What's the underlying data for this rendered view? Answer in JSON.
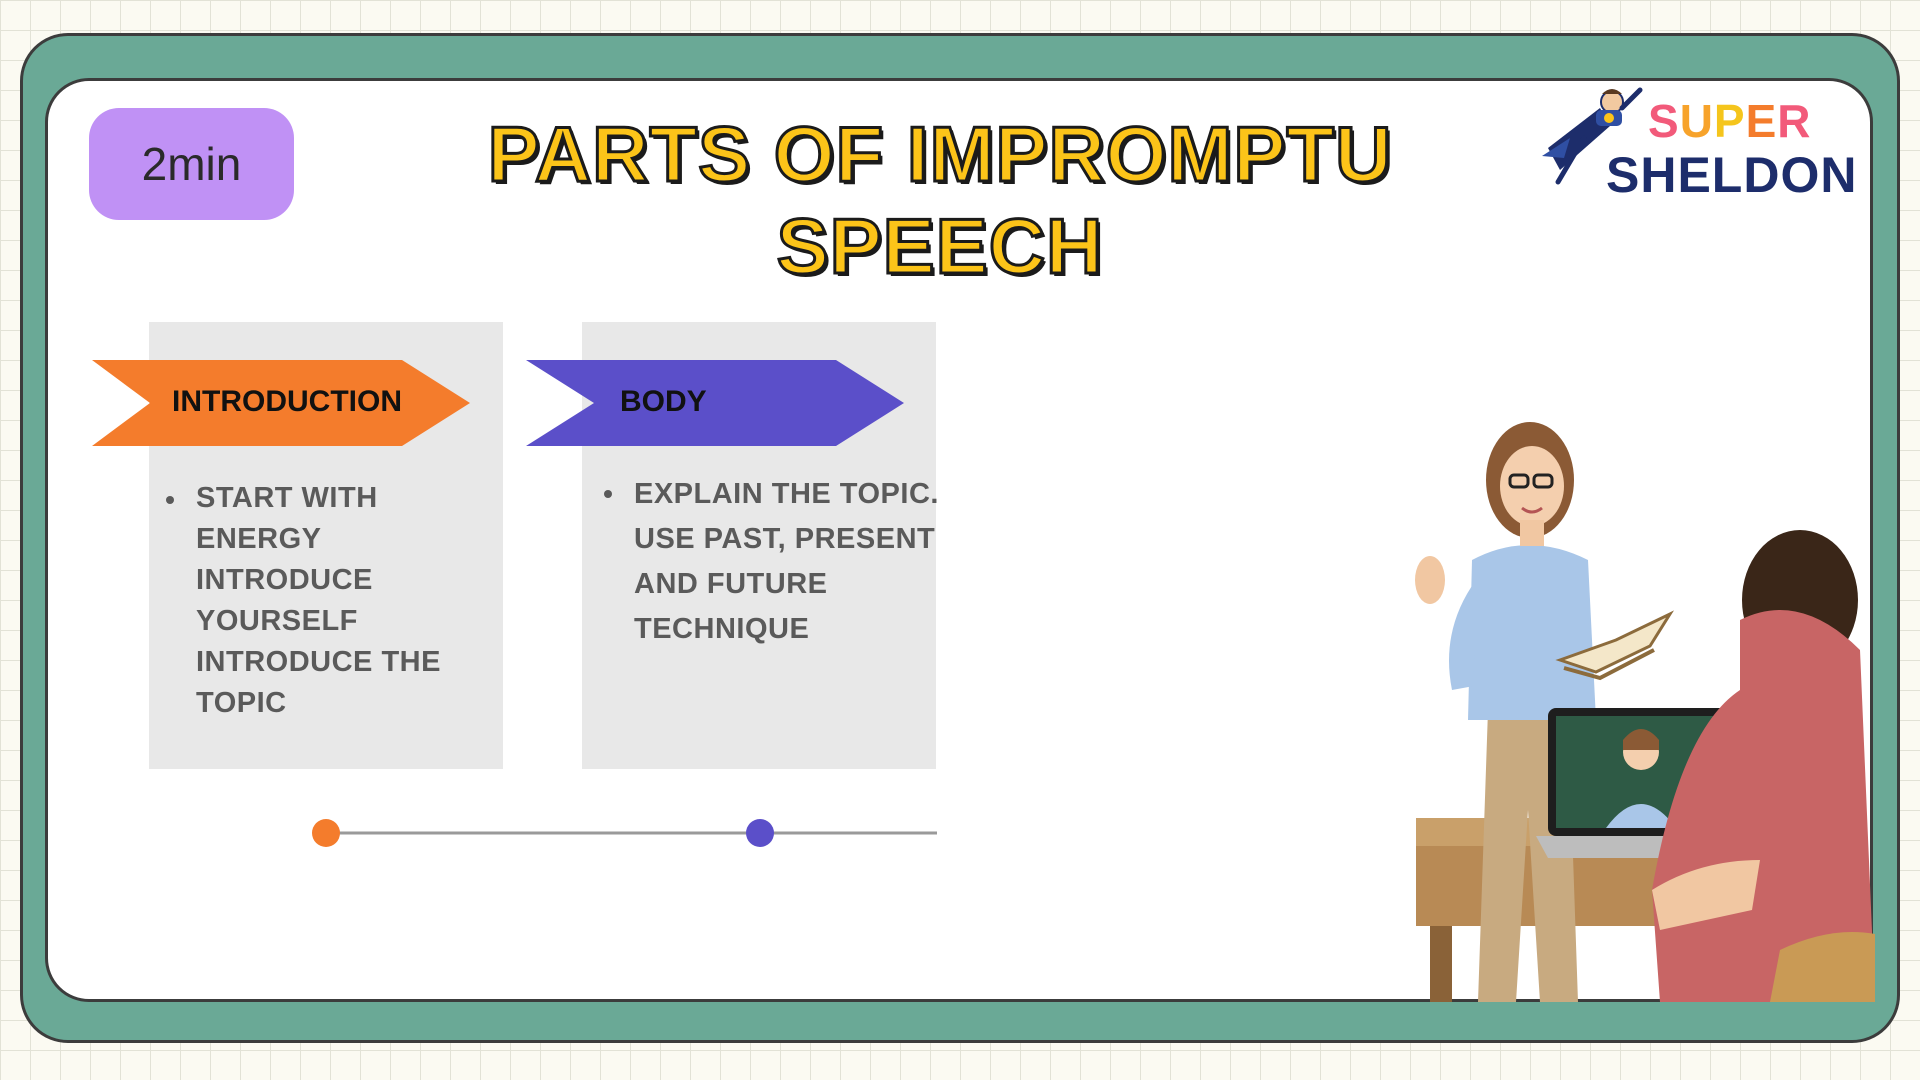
{
  "timer": {
    "label": "2min"
  },
  "title": {
    "line1": "PARTS OF IMPROMPTU",
    "line2": "SPEECH"
  },
  "logo": {
    "word1": "SUPER",
    "word2": "SHELDON"
  },
  "sections": [
    {
      "label": "INTRODUCTION",
      "color": "#f47c2c",
      "bullets": [
        "START WITH ENERGY INTRODUCE YOURSELF INTRODUCE THE TOPIC"
      ]
    },
    {
      "label": "BODY",
      "color": "#5b4fc9",
      "bullets": [
        "EXPLAIN THE TOPIC. USE PAST, PRESENT AND FUTURE TECHNIQUE"
      ]
    }
  ],
  "colors": {
    "frame": "#6aa996",
    "timer_bg": "#c091f5",
    "title_fill": "#fcc419",
    "card_bg": "#e8e8e8",
    "timeline_line": "#9a9a9a"
  },
  "illustration": {
    "description_icon": "teacher-student-laptop-illustration"
  }
}
